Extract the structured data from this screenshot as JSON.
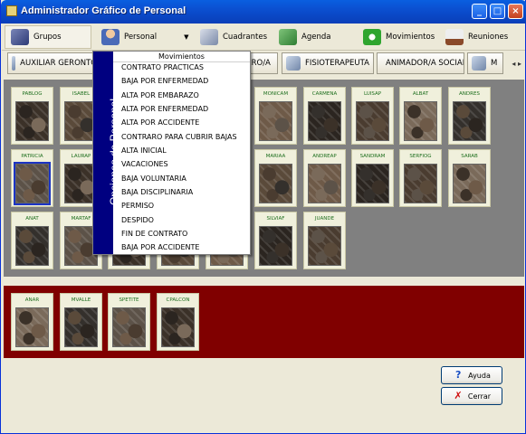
{
  "window": {
    "title": "Administrador Gráfico de Personal"
  },
  "titlebar_buttons": {
    "minimize": "_",
    "maximize": "□",
    "close": "×"
  },
  "toolbar": [
    {
      "label": "Grupos",
      "icon": "tools-icon"
    },
    {
      "label": "Personal",
      "icon": "person-icon"
    },
    {
      "label": "Cuadrantes",
      "icon": "grid-icon"
    },
    {
      "label": "Agenda",
      "icon": "agenda-icon"
    },
    {
      "label": "Movimientos",
      "icon": "recycle-icon"
    },
    {
      "label": "Reuniones",
      "icon": "meeting-icon"
    }
  ],
  "category_tabs": [
    "AUXILIAR GERONTO",
    "ENFERMERO/A",
    "FISIOTERAPEUTA",
    "ANIMADOR/A SOCIAL",
    "M"
  ],
  "scroll": {
    "left": "◂",
    "right": "▸"
  },
  "context_menu": {
    "side_label": "Opciones de Personal",
    "header": "Movimientos",
    "items": [
      "CONTRATO PRACTICAS",
      "BAJA POR ENFERMEDAD",
      "ALTA POR EMBARAZO",
      "ALTA POR ENFERMEDAD",
      "ALTA POR ACCIDENTE",
      "CONTRARO PARA CUBRIR BAJAS",
      "ALTA INICIAL",
      "VACACIONES",
      "BAJA VOLUNTARIA",
      "BAJA DISCIPLINARIA",
      "PERMISO",
      "DESPIDO",
      "FIN DE CONTRATO",
      "BAJA POR ACCIDENTE"
    ]
  },
  "staff_active": [
    "PABLOG",
    "ISABEL",
    "MONICAM",
    "CARMENA",
    "LUISAP",
    "ALBAT",
    "ANDRES",
    "PATRICIA",
    "LAURAP",
    "MARIAA",
    "ANDREAP",
    "SANDRAM",
    "SERFIOG",
    "SARAB",
    "ANAT",
    "MARTAF",
    "SILVIAF",
    "JUANDE"
  ],
  "staff_inactive": [
    "ANAR",
    "MVALLE",
    "SPETITE",
    "CPALCON"
  ],
  "buttons": {
    "help": "Ayuda",
    "close": "Cerrar"
  },
  "colors": {
    "titlebar": "#0a5fe0",
    "active_panel": "#808080",
    "inactive_panel": "#800000",
    "menu_side": "#000080",
    "selected_card": "#1c34c4"
  }
}
